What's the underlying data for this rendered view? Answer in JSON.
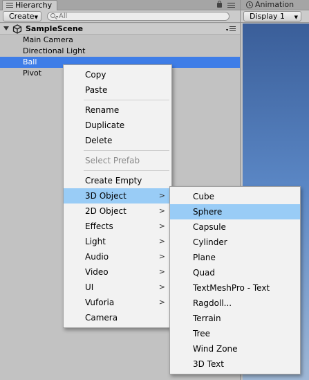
{
  "hierarchy": {
    "tab_label": "Hierarchy",
    "create_label": "Create",
    "search_placeholder": "All",
    "scene_name": "SampleScene",
    "items": [
      {
        "label": "Main Camera"
      },
      {
        "label": "Directional Light"
      },
      {
        "label": "Ball",
        "selected": true
      },
      {
        "label": "Pivot"
      }
    ]
  },
  "game": {
    "tab_label": "Animation",
    "display_label": "Display 1"
  },
  "context_menu": {
    "items": [
      "Copy",
      "Paste",
      "Rename",
      "Duplicate",
      "Delete",
      "Select Prefab",
      "Create Empty",
      "3D Object",
      "2D Object",
      "Effects",
      "Light",
      "Audio",
      "Video",
      "UI",
      "Vuforia",
      "Camera"
    ],
    "highlighted": "3D Object",
    "disabled": [
      "Select Prefab"
    ]
  },
  "submenu_3d_object": {
    "items": [
      "Cube",
      "Sphere",
      "Capsule",
      "Cylinder",
      "Plane",
      "Quad",
      "TextMeshPro - Text",
      "Ragdoll...",
      "Terrain",
      "Tree",
      "Wind Zone",
      "3D Text"
    ],
    "highlighted": "Sphere"
  },
  "colors": {
    "selection": "#3e7de7",
    "menu_highlight": "#99ccf6",
    "panel_bg": "#c2c2c2"
  },
  "icons": [
    "hierarchy-list-icon",
    "lock-icon",
    "panel-menu-icon",
    "search-icon",
    "unity-scene-icon",
    "foldout-arrow-icon",
    "clock-icon",
    "submenu-arrow-icon"
  ]
}
